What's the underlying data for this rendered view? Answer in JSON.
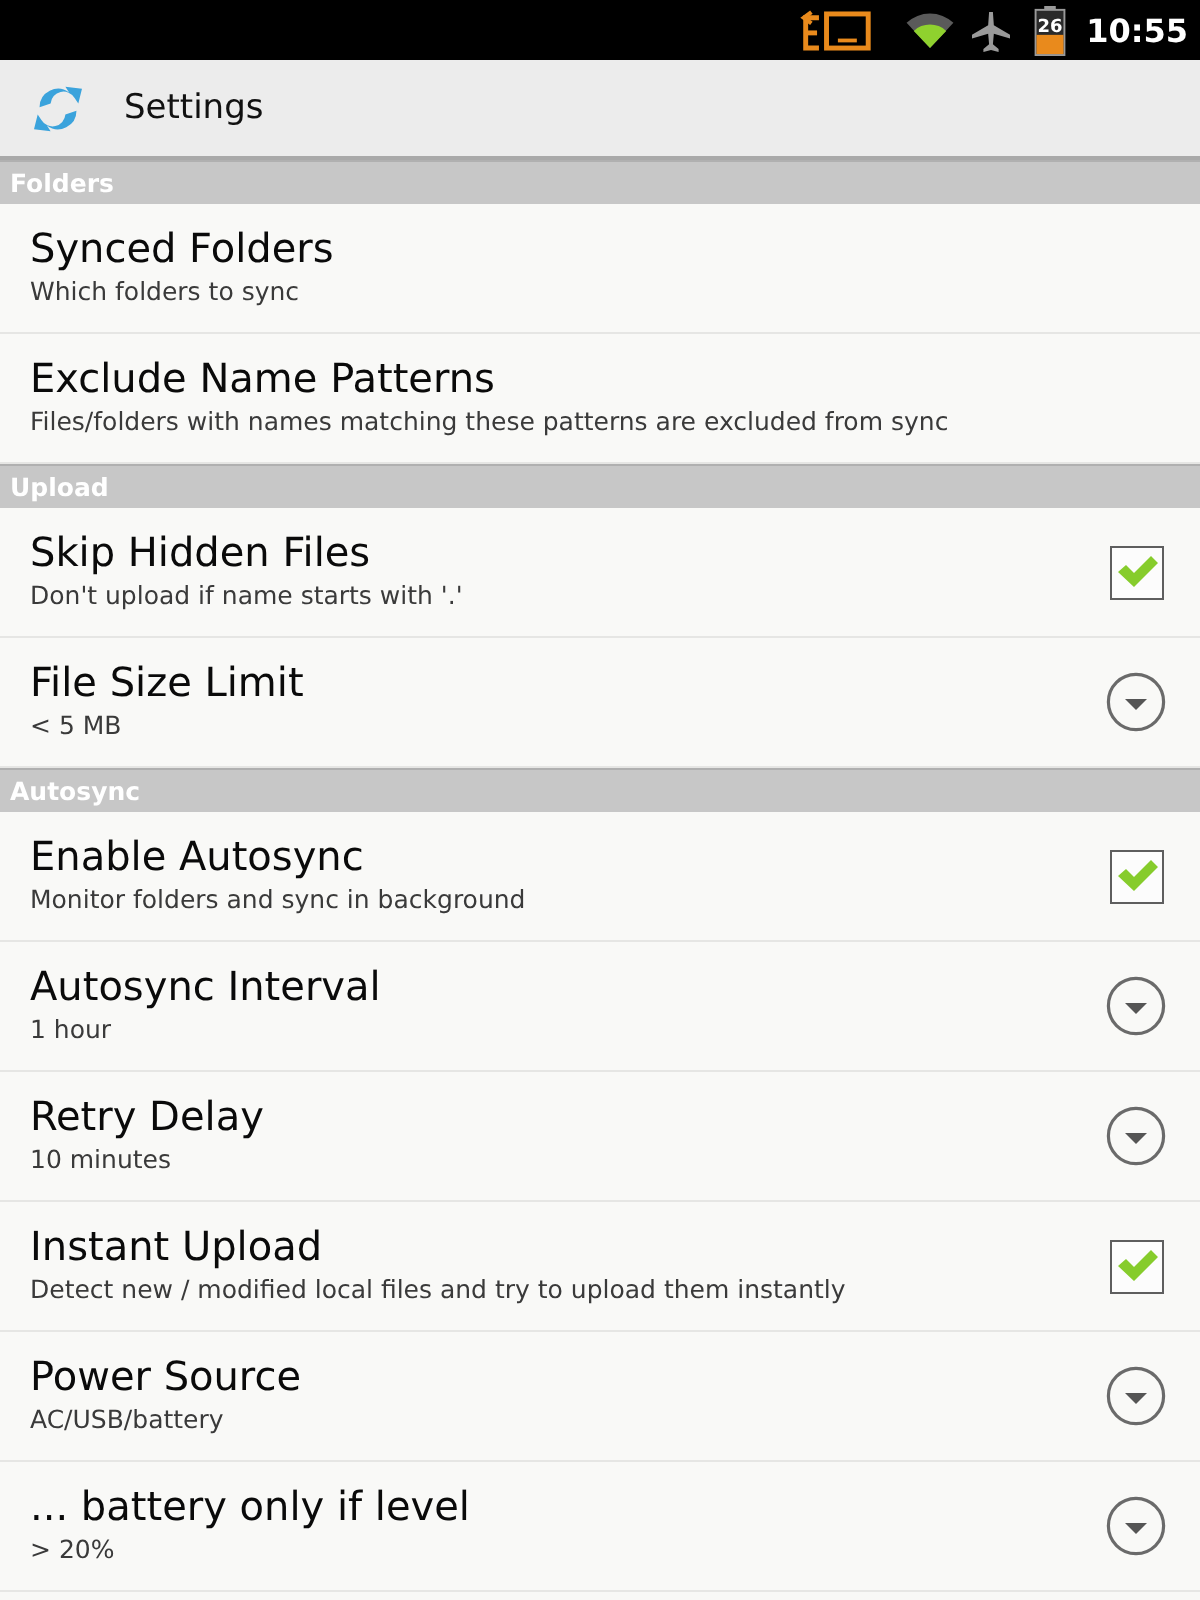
{
  "status_bar": {
    "battery": "26",
    "time": "10:55"
  },
  "title_bar": {
    "title": "Settings"
  },
  "sections": [
    {
      "title": "Folders",
      "items": [
        {
          "kind": "link",
          "title": "Synced Folders",
          "summary": "Which folders to sync"
        },
        {
          "kind": "link",
          "title": "Exclude Name Patterns",
          "summary": "Files/folders with names matching these patterns are excluded from sync"
        }
      ]
    },
    {
      "title": "Upload",
      "items": [
        {
          "kind": "checkbox",
          "title": "Skip Hidden Files",
          "summary": "Don't upload if name starts with '.'",
          "checked": true
        },
        {
          "kind": "list",
          "title": "File Size Limit",
          "summary": "< 5 MB"
        }
      ]
    },
    {
      "title": "Autosync",
      "items": [
        {
          "kind": "checkbox",
          "title": "Enable Autosync",
          "summary": "Monitor folders and sync in background",
          "checked": true
        },
        {
          "kind": "list",
          "title": "Autosync Interval",
          "summary": "1 hour"
        },
        {
          "kind": "list",
          "title": "Retry Delay",
          "summary": "10 minutes"
        },
        {
          "kind": "checkbox",
          "title": "Instant Upload",
          "summary": "Detect new / modified local files and try to upload them instantly",
          "checked": true
        },
        {
          "kind": "list",
          "title": "Power Source",
          "summary": "AC/USB/battery"
        },
        {
          "kind": "list",
          "title": "... battery only if level",
          "summary": "> 20%"
        }
      ]
    }
  ]
}
